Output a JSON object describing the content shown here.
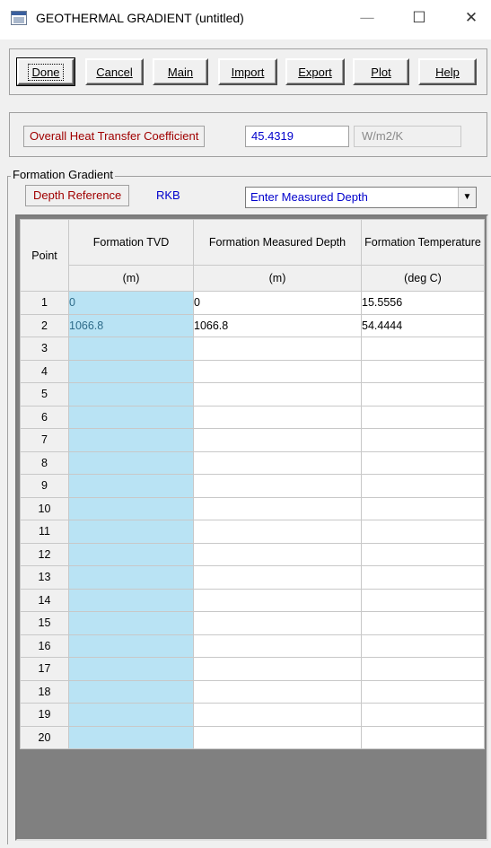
{
  "window": {
    "title": "GEOTHERMAL GRADIENT (untitled)",
    "minimize": "—",
    "maximize": "☐",
    "close": "✕"
  },
  "toolbar": {
    "done": "Done",
    "cancel": "Cancel",
    "main": "Main",
    "import": "Import",
    "export": "Export",
    "plot": "Plot",
    "help": "Help"
  },
  "coefficient": {
    "label": "Overall Heat Transfer Coefficient",
    "value": "45.4319",
    "unit": "W/m2/K"
  },
  "formation": {
    "group_title": "Formation Gradient",
    "depth_reference_label": "Depth Reference",
    "depth_reference_value": "RKB",
    "depth_mode": "Enter Measured Depth"
  },
  "grid": {
    "headers": {
      "point": "Point",
      "tvd": "Formation TVD",
      "md": "Formation Measured Depth",
      "temp": "Formation Temperature"
    },
    "units": {
      "tvd": "(m)",
      "md": "(m)",
      "temp": "(deg C)"
    },
    "rows": [
      {
        "point": "1",
        "tvd": "0",
        "md": "0",
        "temp": "15.5556"
      },
      {
        "point": "2",
        "tvd": "1066.8",
        "md": "1066.8",
        "temp": "54.4444"
      },
      {
        "point": "3",
        "tvd": "",
        "md": "",
        "temp": ""
      },
      {
        "point": "4",
        "tvd": "",
        "md": "",
        "temp": ""
      },
      {
        "point": "5",
        "tvd": "",
        "md": "",
        "temp": ""
      },
      {
        "point": "6",
        "tvd": "",
        "md": "",
        "temp": ""
      },
      {
        "point": "7",
        "tvd": "",
        "md": "",
        "temp": ""
      },
      {
        "point": "8",
        "tvd": "",
        "md": "",
        "temp": ""
      },
      {
        "point": "9",
        "tvd": "",
        "md": "",
        "temp": ""
      },
      {
        "point": "10",
        "tvd": "",
        "md": "",
        "temp": ""
      },
      {
        "point": "11",
        "tvd": "",
        "md": "",
        "temp": ""
      },
      {
        "point": "12",
        "tvd": "",
        "md": "",
        "temp": ""
      },
      {
        "point": "13",
        "tvd": "",
        "md": "",
        "temp": ""
      },
      {
        "point": "14",
        "tvd": "",
        "md": "",
        "temp": ""
      },
      {
        "point": "15",
        "tvd": "",
        "md": "",
        "temp": ""
      },
      {
        "point": "16",
        "tvd": "",
        "md": "",
        "temp": ""
      },
      {
        "point": "17",
        "tvd": "",
        "md": "",
        "temp": ""
      },
      {
        "point": "18",
        "tvd": "",
        "md": "",
        "temp": ""
      },
      {
        "point": "19",
        "tvd": "",
        "md": "",
        "temp": ""
      },
      {
        "point": "20",
        "tvd": "",
        "md": "",
        "temp": ""
      }
    ]
  }
}
